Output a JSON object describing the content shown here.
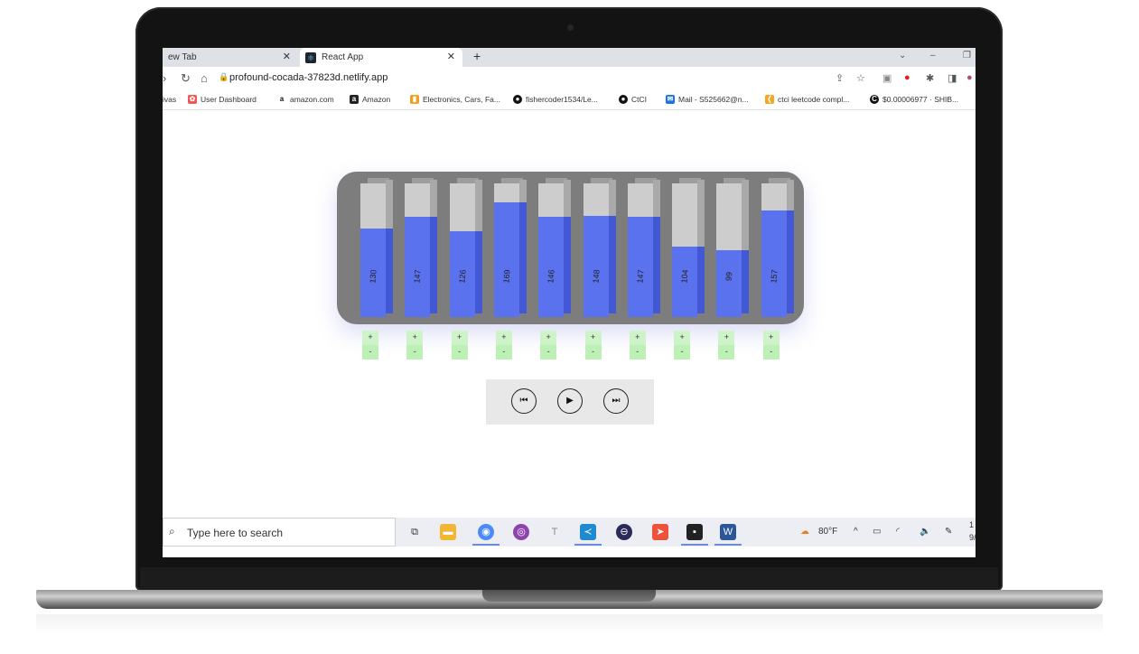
{
  "browser": {
    "tabs": [
      {
        "label": "ew Tab"
      },
      {
        "label": "React App"
      }
    ],
    "url": "profound-cocada-37823d.netlify.app",
    "bookmarks": [
      {
        "label": "ivas"
      },
      {
        "label": "User Dashboard"
      },
      {
        "label": "amazon.com"
      },
      {
        "label": "Amazon"
      },
      {
        "label": "Electronics, Cars, Fa..."
      },
      {
        "label": "fishercoder1534/Le..."
      },
      {
        "label": "CtCI"
      },
      {
        "label": "Mail - S525662@n..."
      },
      {
        "label": "ctci leetcode compl..."
      },
      {
        "label": "$0.00006977 · SHIB..."
      }
    ]
  },
  "app": {
    "bars": [
      {
        "value": 130,
        "fill": 0.66
      },
      {
        "value": 147,
        "fill": 0.75
      },
      {
        "value": 126,
        "fill": 0.64
      },
      {
        "value": 169,
        "fill": 0.86
      },
      {
        "value": 146,
        "fill": 0.75
      },
      {
        "value": 148,
        "fill": 0.76
      },
      {
        "value": 147,
        "fill": 0.75
      },
      {
        "value": 104,
        "fill": 0.53
      },
      {
        "value": 99,
        "fill": 0.5
      },
      {
        "value": 157,
        "fill": 0.8
      }
    ],
    "controls": {
      "plus": "+",
      "minus": "-"
    },
    "player": {
      "prev_icon": "skip-previous-icon",
      "play_icon": "play-icon",
      "next_icon": "skip-next-icon"
    }
  },
  "taskbar": {
    "search_placeholder": "Type here to search",
    "weather": "80°F",
    "time_partial": "1",
    "date_partial": "9/"
  }
}
